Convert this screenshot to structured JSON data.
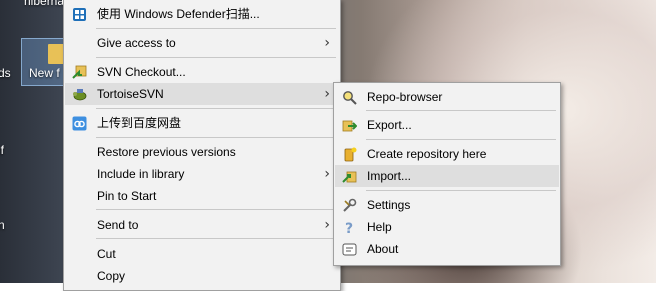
{
  "desktop": {
    "partial_labels": [
      "hiberna",
      "ds",
      "New f",
      "lf",
      "n"
    ],
    "colors": {
      "menu_bg": "#f2f2f2",
      "highlight": "#dedede",
      "separator": "#c8c8c8"
    }
  },
  "context_menu": {
    "items": [
      {
        "label": "使用 Windows Defender扫描...",
        "icon": "windows-defender-icon"
      },
      {
        "label": "Give access to",
        "submenu": true
      },
      {
        "label": "SVN Checkout...",
        "icon": "svn-checkout-icon"
      },
      {
        "label": "TortoiseSVN",
        "icon": "tortoisesvn-icon",
        "submenu": true,
        "highlighted": true
      },
      {
        "label": "上传到百度网盘",
        "icon": "baidu-netdisk-icon"
      },
      {
        "label": "Restore previous versions"
      },
      {
        "label": "Include in library",
        "submenu": true
      },
      {
        "label": "Pin to Start"
      },
      {
        "label": "Send to",
        "submenu": true
      },
      {
        "label": "Cut"
      },
      {
        "label": "Copy"
      }
    ],
    "arrow_glyph": "›"
  },
  "tortoise_submenu": {
    "items": [
      {
        "label": "Repo-browser",
        "icon": "repo-browser-icon"
      },
      {
        "label": "Export...",
        "icon": "export-icon"
      },
      {
        "label": "Create repository here",
        "icon": "create-repository-icon"
      },
      {
        "label": "Import...",
        "icon": "import-icon",
        "highlighted": true
      },
      {
        "label": "Settings",
        "icon": "settings-icon"
      },
      {
        "label": "Help",
        "icon": "help-icon"
      },
      {
        "label": "About",
        "icon": "about-icon"
      }
    ]
  }
}
